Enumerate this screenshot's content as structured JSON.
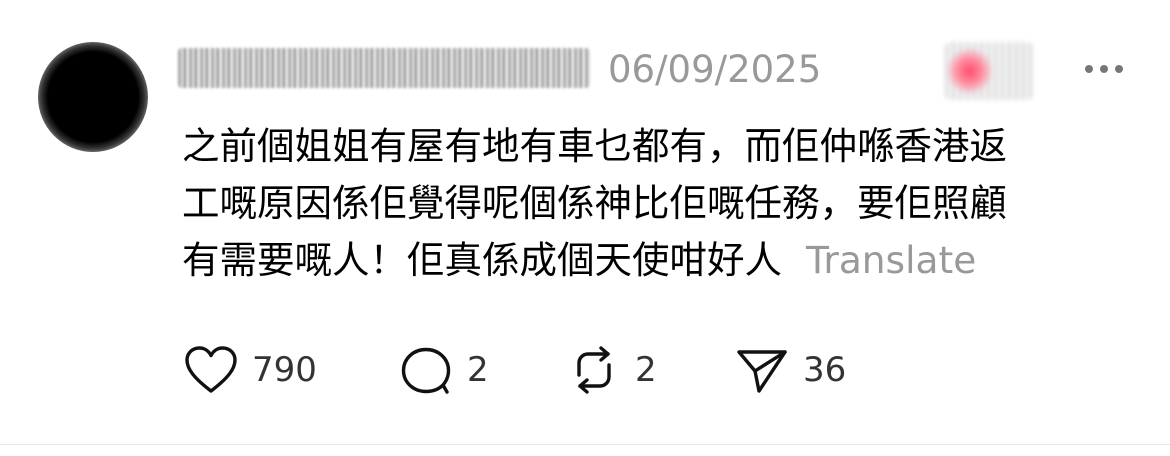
{
  "post": {
    "timestamp": "06/09/2025",
    "text_lines": [
      "之前個姐姐有屋有地有車乜都有，而佢仲喺香港返",
      "工嘅原因係佢覺得呢個係神比佢嘅任務，要佢照顧",
      "有需要嘅人！佢真係成個天使咁好人"
    ],
    "translate_label": "Translate",
    "actions": {
      "likes": "790",
      "replies": "2",
      "reposts": "2",
      "shares": "36"
    }
  },
  "icons": {
    "avatar": "avatar-blurred",
    "more": "more-horizontal-icon",
    "like": "heart-icon",
    "reply": "comment-bubble-icon",
    "repost": "repost-icon",
    "share": "send-icon"
  },
  "colors": {
    "text": "#000000",
    "muted": "#999999",
    "count": "#333333",
    "badge": "#ff3b5c"
  }
}
